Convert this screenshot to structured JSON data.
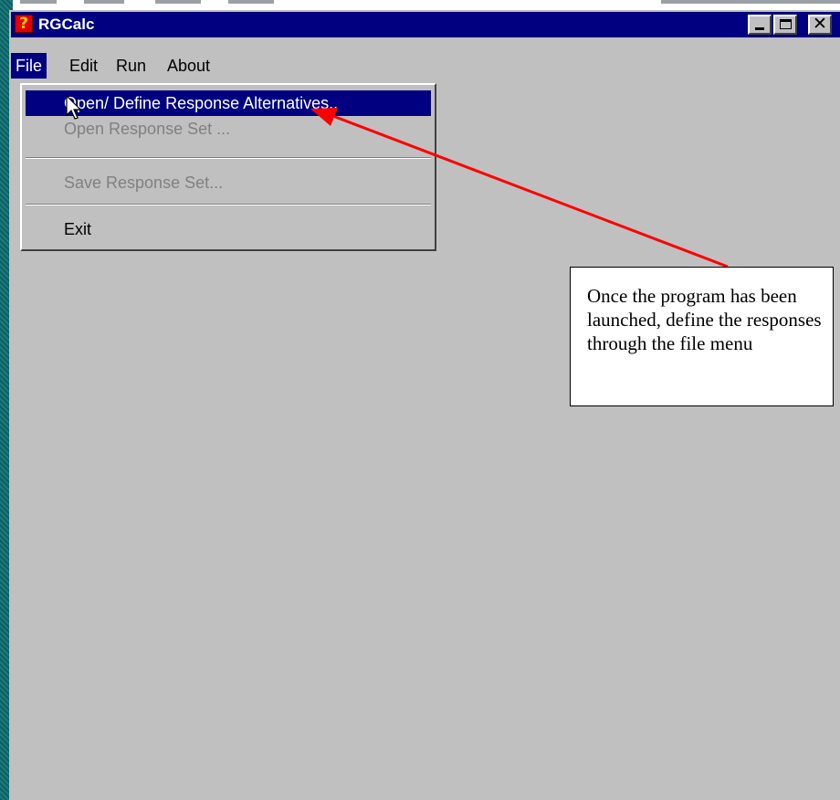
{
  "window": {
    "title": "RGCalc"
  },
  "menubar": {
    "items": [
      {
        "label": "File"
      },
      {
        "label": "Edit"
      },
      {
        "label": "Run"
      },
      {
        "label": "About"
      }
    ]
  },
  "file_menu": {
    "items": [
      {
        "label": "Open/ Define Response Alternatives..",
        "state": "highlighted"
      },
      {
        "label": "Open Response Set ...",
        "state": "disabled"
      },
      {
        "label": "Save Response Set...",
        "state": "disabled"
      },
      {
        "label": "Exit",
        "state": "enabled"
      }
    ]
  },
  "callout": {
    "text": "Once the program has been launched, define the responses through the file menu"
  },
  "colors": {
    "titlebar": "#000080",
    "menu_highlight": "#000080",
    "window_bg": "#c0c0c0",
    "arrow": "#ff0000"
  },
  "icons": {
    "app": "question-app-icon",
    "cursor": "arrow-cursor-icon"
  }
}
